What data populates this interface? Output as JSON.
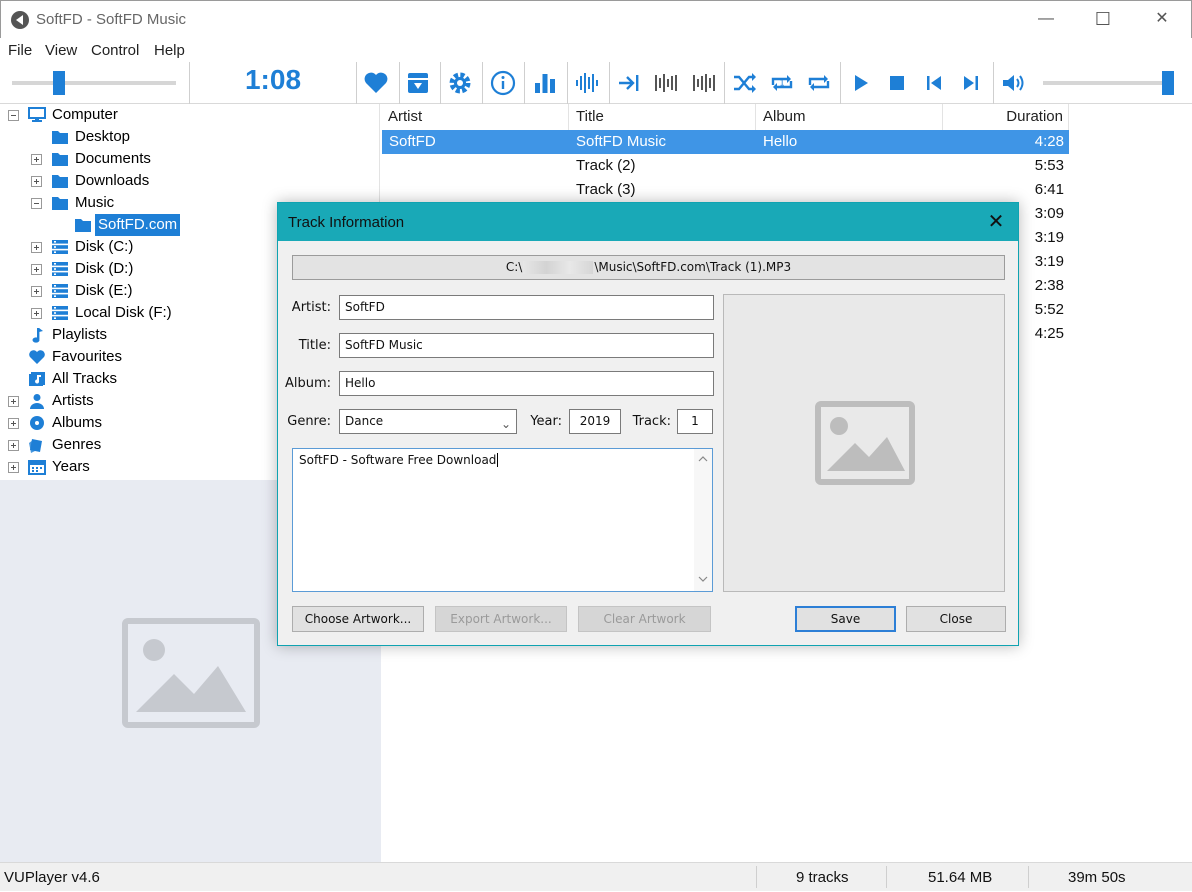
{
  "window": {
    "title": "SoftFD - SoftFD Music",
    "minimize": "—",
    "maximize": "☐",
    "close": "✕"
  },
  "menu": [
    "File",
    "View",
    "Control",
    "Help"
  ],
  "toolbar": {
    "time": "1:08",
    "position_fraction": 0.27,
    "volume_fraction": 1.0,
    "icons": [
      "heart-icon",
      "convert-icon",
      "gear-icon",
      "info-icon",
      "visualiser-icon",
      "waveform-icon",
      "follow-track-icon",
      "crossfade-icon",
      "gapless-icon",
      "shuffle-icon",
      "repeat-one-icon",
      "repeat-all-icon",
      "play-icon",
      "stop-icon",
      "previous-icon",
      "next-icon",
      "volume-icon"
    ],
    "accent": "#1e7fd6"
  },
  "tree": {
    "items": [
      {
        "label": "Computer",
        "expander": "minus",
        "icon": "monitor-icon"
      },
      {
        "label": "Desktop",
        "expander": "",
        "icon": "folder-icon"
      },
      {
        "label": "Documents",
        "expander": "plus",
        "icon": "folder-icon"
      },
      {
        "label": "Downloads",
        "expander": "plus",
        "icon": "folder-icon"
      },
      {
        "label": "Music",
        "expander": "minus",
        "icon": "folder-icon"
      },
      {
        "label": "SoftFD.com",
        "expander": "",
        "icon": "folder-icon",
        "selected": true
      },
      {
        "label": "Disk (C:)",
        "expander": "plus",
        "icon": "drive-icon"
      },
      {
        "label": "Disk (D:)",
        "expander": "plus",
        "icon": "drive-icon"
      },
      {
        "label": "Disk (E:)",
        "expander": "plus",
        "icon": "drive-icon"
      },
      {
        "label": "Local Disk (F:)",
        "expander": "plus",
        "icon": "drive-icon"
      },
      {
        "label": "Playlists",
        "expander": "",
        "icon": "music-note-icon"
      },
      {
        "label": "Favourites",
        "expander": "",
        "icon": "heart-icon"
      },
      {
        "label": "All Tracks",
        "expander": "",
        "icon": "all-tracks-icon"
      },
      {
        "label": "Artists",
        "expander": "plus",
        "icon": "person-icon"
      },
      {
        "label": "Albums",
        "expander": "plus",
        "icon": "disc-icon"
      },
      {
        "label": "Genres",
        "expander": "plus",
        "icon": "genre-icon"
      },
      {
        "label": "Years",
        "expander": "plus",
        "icon": "calendar-icon"
      }
    ]
  },
  "list": {
    "columns": [
      "Artist",
      "Title",
      "Album",
      "Duration"
    ],
    "rows": [
      {
        "artist": "SoftFD",
        "title": "SoftFD Music",
        "album": "Hello",
        "duration": "4:28",
        "selected": true
      },
      {
        "artist": "",
        "title": "Track (2)",
        "album": "",
        "duration": "5:53"
      },
      {
        "artist": "",
        "title": "Track (3)",
        "album": "",
        "duration": "6:41"
      },
      {
        "artist": "",
        "title": "",
        "album": "",
        "duration": "3:09"
      },
      {
        "artist": "",
        "title": "",
        "album": "",
        "duration": "3:19"
      },
      {
        "artist": "",
        "title": "",
        "album": "",
        "duration": "3:19"
      },
      {
        "artist": "",
        "title": "",
        "album": "",
        "duration": "2:38"
      },
      {
        "artist": "",
        "title": "",
        "album": "",
        "duration": "5:52"
      },
      {
        "artist": "",
        "title": "",
        "album": "",
        "duration": "4:25"
      }
    ]
  },
  "status": {
    "version": "VUPlayer v4.6",
    "tracks": "9 tracks",
    "size": "51.64 MB",
    "total": "39m 50s"
  },
  "dialog": {
    "title": "Track Information",
    "close": "✕",
    "path_prefix": "C:\\",
    "path_suffix": "\\Music\\SoftFD.com\\Track (1).MP3",
    "labels": {
      "artist": "Artist:",
      "title": "Title:",
      "album": "Album:",
      "genre": "Genre:",
      "year": "Year:",
      "track": "Track:"
    },
    "values": {
      "artist": "SoftFD",
      "title": "SoftFD Music",
      "album": "Hello",
      "genre": "Dance",
      "year": "2019",
      "track": "1"
    },
    "comment": "SoftFD - Software Free Download",
    "buttons": {
      "choose": "Choose Artwork...",
      "export": "Export Artwork...",
      "clear": "Clear Artwork",
      "save": "Save",
      "close": "Close"
    },
    "title_color": "#19a9b7"
  }
}
